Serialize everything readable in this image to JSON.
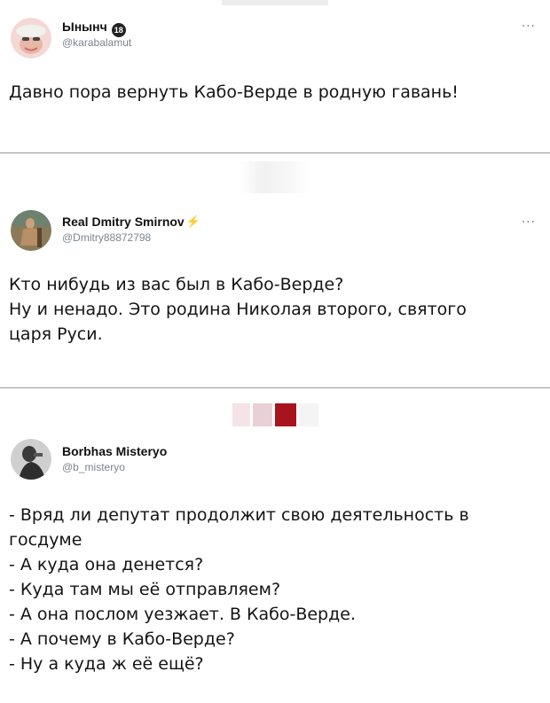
{
  "tweets": [
    {
      "name": "Ынынч",
      "badge": "18",
      "handle": "@karabalamut",
      "more": "···",
      "lines": [
        "Давно пора вернуть Кабо-Верде в родную гавань!"
      ]
    },
    {
      "name": "Real Dmitry Smirnov",
      "handle": "@Dmitry88872798",
      "more": "···",
      "lines": [
        "Кто нибудь из вас был в Кабо-Верде?",
        "Ну и ненадо. Это родина Николая второго, святого",
        "царя Руси."
      ]
    },
    {
      "name": "Borbhas Misteryo",
      "handle": "@b_misteryo",
      "lines": [
        "- Вряд ли депутат продолжит свою деятельность в",
        "госдуме",
        "- А куда она денется?",
        "- Куда там мы её отправляем?",
        "- А она послом уезжает. В Кабо-Верде.",
        "- А почему в Кабо-Верде?",
        "- Ну а куда ж её ещё?"
      ]
    }
  ],
  "colors": {
    "divider": "#9a9a9a",
    "handle": "#7a8590",
    "bolt": "#f2b600"
  }
}
